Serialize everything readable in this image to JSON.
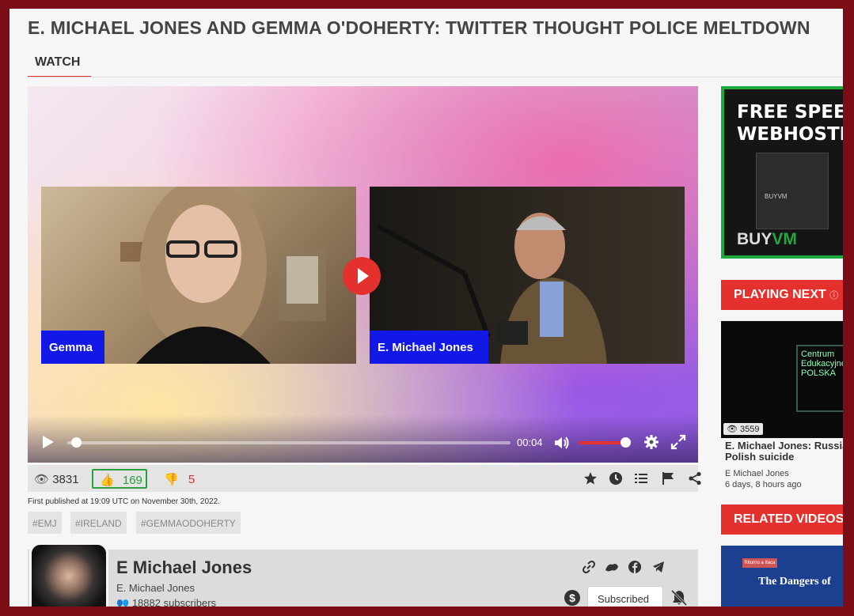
{
  "page": {
    "title": "E. MICHAEL JONES AND GEMMA O'DOHERTY: TWITTER THOUGHT POLICE MELTDOWN",
    "tab_watch": "WATCH"
  },
  "video": {
    "left_name": "Gemma",
    "right_name": "E. Michael Jones",
    "time": "00:04",
    "progress": 0.01,
    "volume": 1.0
  },
  "stats": {
    "views": "3831",
    "likes": "169",
    "dislikes": "5"
  },
  "published": "First published at 19:09 UTC on November 30th, 2022.",
  "tags": [
    "#EMJ",
    "#IRELAND",
    "#GEMMAODOHERTY"
  ],
  "channel": {
    "name": "E Michael Jones",
    "handle": "E. Michael Jones",
    "subscribers": "18882 subscribers",
    "subscribe_label": "Subscribed"
  },
  "ad": {
    "line1": "FREE SPEECH",
    "line2": "WEBHOSTING",
    "server_label": "BUYVM",
    "brand_buy": "BUY",
    "brand_vm": "VM"
  },
  "sidebar": {
    "playing_next": "PLAYING NEXT",
    "related": "RELATED VIDEOS",
    "next_video": {
      "views": "3559",
      "title_line1": "E. Michael Jones: Russian",
      "title_line2": "Polish suicide",
      "author": "E Michael Jones",
      "time": "6 days, 8 hours ago",
      "thumb_text": "Centrum Edukacyjne POLSKA"
    },
    "related_video": {
      "badge": "Ritorno a Itaca",
      "title": "The Dangers of"
    }
  },
  "colors": {
    "accent": "#e5312e",
    "like_green": "#2a9d3c",
    "frame": "#7a0d16"
  }
}
